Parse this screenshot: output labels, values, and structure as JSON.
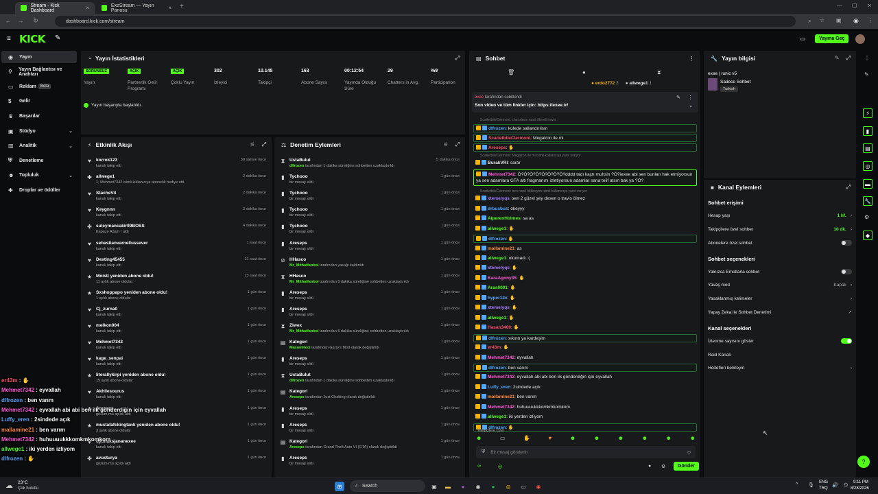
{
  "browser": {
    "tabs": [
      {
        "title": "Stream - Kick Dashboard"
      },
      {
        "title": "ExeStream — Yayın Panosu"
      }
    ],
    "url": "dashboard.kick.com/stream"
  },
  "topbar": {
    "logo": "KICK",
    "cta": "Yayına Geç"
  },
  "sidebar": {
    "items": [
      {
        "label": "Yayın",
        "icon": "circle-icon"
      },
      {
        "label": "Yayın Bağlantısı ve Anahtarı",
        "icon": "link-icon"
      },
      {
        "label": "Reklam",
        "icon": "tv-icon",
        "badge": "Beta"
      },
      {
        "label": "Gelir",
        "icon": "dollar-icon"
      },
      {
        "label": "Başarılar",
        "icon": "trophy-icon"
      },
      {
        "label": "Stüdyo",
        "icon": "studio-icon",
        "chevron": true
      },
      {
        "label": "Analitik",
        "icon": "chart-icon",
        "chevron": true
      },
      {
        "label": "Denetleme",
        "icon": "shield-icon"
      },
      {
        "label": "Topluluk",
        "icon": "people-icon",
        "chevron": true
      },
      {
        "label": "Droplar ve ödüller",
        "icon": "gift-icon"
      }
    ]
  },
  "stats": {
    "title": "Yayın İstatistikleri",
    "status": "Yayın başarıyla başlatıldı.",
    "items": [
      {
        "badge": "SORUNSUZ",
        "label": "Yayın"
      },
      {
        "badge": "AÇIK",
        "label": "Partnerlik Gelir Programı"
      },
      {
        "badge": "AÇIK",
        "label": "Çoklu Yayın"
      },
      {
        "value": "302",
        "label": "İzleyici"
      },
      {
        "value": "10.145",
        "label": "Takipçi"
      },
      {
        "value": "163",
        "label": "Abone Sayısı"
      },
      {
        "value": "00:12:54",
        "label": "Yayında Olduğu Süre"
      },
      {
        "value": "29",
        "label": "Chatters in Avg."
      },
      {
        "value": "%9",
        "label": "Participation"
      }
    ]
  },
  "activity": {
    "title": "Etkinlik Akışı",
    "rows": [
      {
        "name": "korrok123",
        "sub": "kanalı takip etti",
        "time": "50 saniye önce",
        "icon": "heart-icon"
      },
      {
        "name": "allwege1",
        "sub": "1, Mehmet7342 isimli kullanıcıya abonelik hediye etti.",
        "time": "2 dakika önce",
        "icon": "gift-icon"
      },
      {
        "name": "StacheV4",
        "sub": "kanalı takip etti",
        "time": "2 dakika önce",
        "icon": "heart-icon"
      },
      {
        "name": "Keygnnn",
        "sub": "kanalı takip etti",
        "time": "3 dakika önce",
        "icon": "heart-icon"
      },
      {
        "name": "suleymancakir99BOSS",
        "sub": "Kapaze Adam ! aldı",
        "time": "4 dakika önce",
        "icon": "reward-icon"
      },
      {
        "name": "sebastianvarnellussever",
        "sub": "kanalı takip etti",
        "time": "1 saat önce",
        "icon": "heart-icon"
      },
      {
        "name": "Dexting45455",
        "sub": "kanalı takip etti",
        "time": "21 saat önce",
        "icon": "heart-icon"
      },
      {
        "name": "Moisti yeniden abone oldu!",
        "sub": "11 aylık abone oldular",
        "time": "23 saat önce",
        "icon": "star-icon"
      },
      {
        "name": "Sxshoppapo yeniden abone oldu!",
        "sub": "1 aylık abone oldular",
        "time": "1 gün önce",
        "icon": "star-icon"
      },
      {
        "name": "Cj_zurna0",
        "sub": "kanalı takip etti",
        "time": "1 gün önce",
        "icon": "heart-icon"
      },
      {
        "name": "melkon004",
        "sub": "kanalı takip etti",
        "time": "1 gün önce",
        "icon": "heart-icon"
      },
      {
        "name": "Mehmet7342",
        "sub": "kanalı takip etti",
        "time": "1 gün önce",
        "icon": "heart-icon"
      },
      {
        "name": "kage_senpai",
        "sub": "kanalı takip etti",
        "time": "1 gün önce",
        "icon": "heart-icon"
      },
      {
        "name": "literallykirpi yeniden abone oldu!",
        "sub": "15 aylık abone oldular",
        "time": "1 gün önce",
        "icon": "star-icon"
      },
      {
        "name": "Akhilesourus",
        "sub": "kanalı takip etti",
        "time": "1 gün önce",
        "icon": "heart-icon"
      },
      {
        "name": "Areseps",
        "sub": "gözüm mü açıldı aldı",
        "time": "1 gün önce",
        "icon": "reward-icon"
      },
      {
        "name": "mustafafckingtank yeniden abone oldu!",
        "sub": "3 aylık abone oldular",
        "time": "1 gün önce",
        "icon": "star-icon"
      },
      {
        "name": "dybnaksjananexee",
        "sub": "kanalı takip etti",
        "time": "1 gün önce",
        "icon": "heart-icon"
      },
      {
        "name": "avusturya",
        "sub": "gözüm mü açıldı aldı",
        "time": "1 gün önce",
        "icon": "reward-icon"
      }
    ]
  },
  "moderation": {
    "title": "Denetim Eylemleri",
    "rows": [
      {
        "name": "UstaBulut",
        "sub": "tarafından 1 dakika süreliğine sohbetten uzaklaştırıldı",
        "actor": "dlfrozen",
        "time": "5 dakika önce",
        "icon": "hourglass-icon"
      },
      {
        "name": "Tychooo",
        "sub": "bir mesajı sildi",
        "time": "1 gün önce",
        "icon": "trash-icon"
      },
      {
        "name": "Tychooo",
        "sub": "bir mesajı sildi",
        "time": "1 gün önce",
        "icon": "trash-icon"
      },
      {
        "name": "Tychooo",
        "sub": "bir mesajı sildi",
        "time": "1 gün önce",
        "icon": "trash-icon"
      },
      {
        "name": "Tychooo",
        "sub": "bir mesajı sildi",
        "time": "1 gün önce",
        "icon": "trash-icon"
      },
      {
        "name": "Areseps",
        "sub": "bir mesajı sildi",
        "time": "1 gün önce",
        "icon": "trash-icon"
      },
      {
        "name": "HHasco",
        "sub": "tarafından yasağı kaldırıldı",
        "actor": "Mr_Mithatfanboi",
        "time": "1 gün önce",
        "icon": "unban-icon"
      },
      {
        "name": "HHasco",
        "sub": "tarafından 5 dakika süreliğine sohbetten uzaklaştırıldı",
        "actor": "Mr_Mithatfanboi",
        "time": "1 gün önce",
        "icon": "hourglass-icon"
      },
      {
        "name": "Areseps",
        "sub": "bir mesajı sildi",
        "time": "1 gün önce",
        "icon": "trash-icon"
      },
      {
        "name": "Areseps",
        "sub": "bir mesajı sildi",
        "time": "1 gün önce",
        "icon": "trash-icon"
      },
      {
        "name": "Ziwex",
        "sub": "tarafından 5 dakika süreliğine sohbetten uzaklaştırıldı",
        "actor": "Mr_Mithatfanboi",
        "time": "1 gün önce",
        "icon": "hourglass-icon"
      },
      {
        "name": "Kategori",
        "sub": "tarafından Garry's Mod olarak değiştirildi",
        "actor": "MasumKeci",
        "time": "1 gün önce",
        "icon": "category-icon"
      },
      {
        "name": "Areseps",
        "sub": "bir mesajı sildi",
        "time": "1 gün önce",
        "icon": "trash-icon"
      },
      {
        "name": "UstaBulut",
        "sub": "tarafından 1 dakika süreliğine sohbetten uzaklaştırıldı",
        "actor": "dlfrozen",
        "time": "1 gün önce",
        "icon": "hourglass-icon"
      },
      {
        "name": "Kategori",
        "sub": "tarafından Just Chatting olarak değiştirildi",
        "actor": "Areseps",
        "time": "1 gün önce",
        "icon": "category-icon"
      },
      {
        "name": "Areseps",
        "sub": "bir mesajı sildi",
        "time": "1 gün önce",
        "icon": "trash-icon"
      },
      {
        "name": "Areseps",
        "sub": "bir mesajı sildi",
        "time": "1 gün önce",
        "icon": "trash-icon"
      },
      {
        "name": "Kategori",
        "sub": "tarafından Grand Theft Auto VI (GTA) olarak değiştirildi",
        "actor": "Areseps",
        "time": "1 gün önce",
        "icon": "category-icon"
      },
      {
        "name": "Areseps",
        "sub": "bir mesajı sildi",
        "time": "1 gün önce",
        "icon": "trash-icon"
      }
    ]
  },
  "chat": {
    "title": "Sohbet",
    "top_users": [
      {
        "name": "erdo2772",
        "count": "2"
      },
      {
        "name": "allwege1",
        "count": "1"
      }
    ],
    "pinned_by": "tarafından sabitlendi",
    "pinned": "Son video ve tüm linkler için: https://exee.tr/",
    "messages": [
      {
        "reply": "ScarletbileClermont: chat elnce nasıl öltmeli travis",
        "user": "",
        "text": "",
        "sys": true
      },
      {
        "user": "dlfrozen",
        "color": "#53a8ff",
        "text": "kulede sallandırılsın",
        "hl": true
      },
      {
        "user": "ScarletbileClermont",
        "color": "#ff4d6d",
        "text": "Megatron ile mi",
        "hl": true
      },
      {
        "user": "Areseps",
        "color": "#ff4d6d",
        "text": "",
        "hl": true
      },
      {
        "reply": "ScarletbileClermont: Megatron ile mi isimli kullanıcıya yanıt veriyor",
        "sys": true
      },
      {
        "user": "BurakVRI",
        "color": "#e6e6e6",
        "text": "sarar"
      },
      {
        "user": "Mehmet7342",
        "color": "#ff5ad8",
        "text": "Ö?Ö?Ö?Ö?Ö?Ö?Ö?Ö?dddd tadı kaçtı muhsin ?Ö?iexee abi sen bunları hak etmiyorsun ya sen adamlara GTA altı fragmanını izletiyorsun adamlar sana telif atsın bak ya ?Ö?",
        "big": true
      },
      {
        "reply": "ScarletbileClermont: ben nasıl öldüreyim isimli kullanıcıya yanıt veriyor",
        "sys": true
      },
      {
        "user": "xtemelyqs",
        "color": "#a67cff",
        "text": "sen 2 güzel şey desen o travis ölmez"
      },
      {
        "user": "drbusbus",
        "color": "#53a8ff",
        "text": "okeyyy"
      },
      {
        "user": "AlperenHolmes",
        "color": "#53fc18",
        "text": "sa as"
      },
      {
        "user": "allwege1",
        "color": "#53fc18",
        "text": ""
      },
      {
        "user": "dlfrozen",
        "color": "#53a8ff",
        "text": "",
        "hl": true
      },
      {
        "user": "mallamine21",
        "color": "#ff8c3a",
        "text": "as"
      },
      {
        "user": "allwege1",
        "color": "#53fc18",
        "text": "okumadı :("
      },
      {
        "user": "xtemelyqs",
        "color": "#a67cff",
        "text": ""
      },
      {
        "user": "KaraAgony35",
        "color": "#ff5ad8",
        "text": ""
      },
      {
        "user": "Aras0001",
        "color": "#53fc18",
        "text": ""
      },
      {
        "user": "hyper12x",
        "color": "#53a8ff",
        "text": ""
      },
      {
        "user": "xtemelyqs",
        "color": "#a67cff",
        "text": ""
      },
      {
        "user": "allwege1",
        "color": "#53fc18",
        "text": ""
      },
      {
        "user": "Hasan3469",
        "color": "#ff4d6d",
        "text": ""
      },
      {
        "user": "dlfrozen",
        "color": "#53a8ff",
        "text": "sıkıntı ya kardeşim",
        "hl": true
      },
      {
        "user": "er43m",
        "color": "#ff4d6d",
        "text": ""
      },
      {
        "user": "Mehmet7342",
        "color": "#ff5ad8",
        "text": "eyvallah"
      },
      {
        "user": "dlfrozen",
        "color": "#53a8ff",
        "text": "ben varım",
        "hl": true
      },
      {
        "user": "Mehmet7342",
        "color": "#ff5ad8",
        "text": "eyvallah abi abi ben ilk gönderdiğin için eyvallah"
      },
      {
        "user": "Luffy_eren",
        "color": "#53a8ff",
        "text": "2sindede açık"
      },
      {
        "user": "mallamine21",
        "color": "#ff8c3a",
        "text": "ben varım"
      },
      {
        "user": "Mehmet7342",
        "color": "#ff5ad8",
        "text": "huhuuuukkkomkmkomkom"
      },
      {
        "user": "allwege1",
        "color": "#53fc18",
        "text": "iki yerden izliyom"
      },
      {
        "user": "dlfrozen",
        "color": "#53a8ff",
        "text": "",
        "hl": true
      }
    ],
    "followers_only": "Takipçilere Özel",
    "input_placeholder": "Bir mesaj gönderin",
    "send": "Gönder"
  },
  "overlay": [
    {
      "user": "er43m",
      "color": "#ff4d6d",
      "text": ""
    },
    {
      "user": "Mehmet7342",
      "color": "#ff5ad8",
      "text": "eyvallah"
    },
    {
      "user": "dlfrozen",
      "color": "#53a8ff",
      "text": "ben varım"
    },
    {
      "user": "Mehmet7342",
      "color": "#ff5ad8",
      "text": "eyvallah abi abi ben ilk gönderdiğin için eyvallah"
    },
    {
      "user": "Luffy_eren",
      "color": "#53a8ff",
      "text": "2sindede açık"
    },
    {
      "user": "mallamine21",
      "color": "#ff8c3a",
      "text": "ben varım"
    },
    {
      "user": "Mehmet7342",
      "color": "#ff5ad8",
      "text": "huhuuuukkkomkmkomkom"
    },
    {
      "user": "allwege1",
      "color": "#53fc18",
      "text": "iki yerden izliyom"
    },
    {
      "user": "dlfrozen",
      "color": "#53a8ff",
      "text": ""
    }
  ],
  "info": {
    "title": "Yayın bilgisi",
    "stream_title": "exee | runic v5",
    "mode": "Sadece Sohbet",
    "language": "Turkish"
  },
  "channel": {
    "title": "Kanal Eylemleri",
    "chat_access": "Sohbet erişimi",
    "account_age": {
      "label": "Hesap yaşı",
      "value": "1 hf."
    },
    "followers_only": {
      "label": "Takipçilere özel sohbet",
      "value": "10 dk."
    },
    "subs_only": {
      "label": "Abonelere özel sohbet"
    },
    "chat_options": "Sohbet seçenekleri",
    "emotes_only": {
      "label": "Yalnızca Emotlarla sohbet"
    },
    "slow_mode": {
      "label": "Yavaş mod",
      "value": "Kapalı"
    },
    "banned_words": {
      "label": "Yasaklanmış kelimeler"
    },
    "ai_mod": {
      "label": "Yapay Zeka ile Sohbet Denetimi"
    },
    "channel_options": "Kanal seçenekleri",
    "show_viewers": {
      "label": "İzlenme sayısını göster"
    },
    "raid": {
      "label": "Raid Kanalı"
    },
    "goals": {
      "label": "Hedefleri belirleyin"
    }
  },
  "taskbar": {
    "temp": "23°C",
    "weather": "Çok bulutlu",
    "search": "Search",
    "lang": "ENG",
    "region": "TRQ",
    "time": "9:11 PM",
    "date": "8/28/2026"
  },
  "colors": {
    "accent": "#53fc18",
    "panel": "#18191b",
    "bg": "#0b0c0d"
  }
}
